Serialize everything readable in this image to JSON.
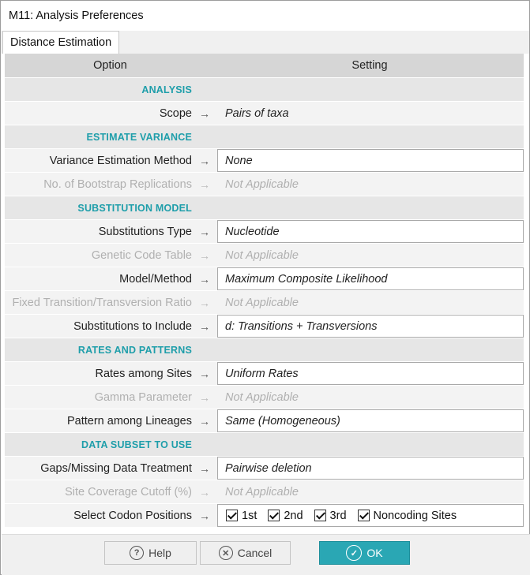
{
  "window": {
    "title": "M11: Analysis Preferences"
  },
  "tabs": [
    {
      "label": "Distance Estimation"
    }
  ],
  "table_header": {
    "option": "Option",
    "setting": "Setting"
  },
  "sections": {
    "analysis": "ANALYSIS",
    "estimate_variance": "ESTIMATE VARIANCE",
    "substitution_model": "SUBSTITUTION MODEL",
    "rates_and_patterns": "RATES AND PATTERNS",
    "data_subset": "DATA SUBSET TO USE"
  },
  "rows": {
    "scope": {
      "label": "Scope",
      "value": "Pairs of taxa"
    },
    "variance_method": {
      "label": "Variance Estimation Method",
      "value": "None"
    },
    "bootstrap": {
      "label": "No. of Bootstrap Replications",
      "value": "Not Applicable"
    },
    "subst_type": {
      "label": "Substitutions Type",
      "value": "Nucleotide"
    },
    "genetic_code": {
      "label": "Genetic Code Table",
      "value": "Not Applicable"
    },
    "model": {
      "label": "Model/Method",
      "value": "Maximum Composite Likelihood"
    },
    "ts_tv_ratio": {
      "label": "Fixed Transition/Transversion Ratio",
      "value": "Not Applicable"
    },
    "subst_include": {
      "label": "Substitutions to Include",
      "value": "d: Transitions + Transversions"
    },
    "rates_sites": {
      "label": "Rates among Sites",
      "value": "Uniform Rates"
    },
    "gamma": {
      "label": "Gamma Parameter",
      "value": "Not Applicable"
    },
    "pattern": {
      "label": "Pattern among Lineages",
      "value": "Same (Homogeneous)"
    },
    "gaps": {
      "label": "Gaps/Missing Data Treatment",
      "value": "Pairwise deletion"
    },
    "coverage": {
      "label": "Site Coverage Cutoff (%)",
      "value": "Not Applicable"
    },
    "codon": {
      "label": "Select Codon Positions"
    }
  },
  "codon_positions": {
    "first": {
      "label": "1st",
      "checked": true
    },
    "second": {
      "label": "2nd",
      "checked": true
    },
    "third": {
      "label": "3rd",
      "checked": true
    },
    "noncoding": {
      "label": "Noncoding Sites",
      "checked": true
    }
  },
  "arrow_glyph": "→",
  "buttons": {
    "help": "Help",
    "cancel": "Cancel",
    "ok": "OK"
  },
  "colors": {
    "accent": "#2aa7b4",
    "section_text": "#1e9eaa"
  }
}
